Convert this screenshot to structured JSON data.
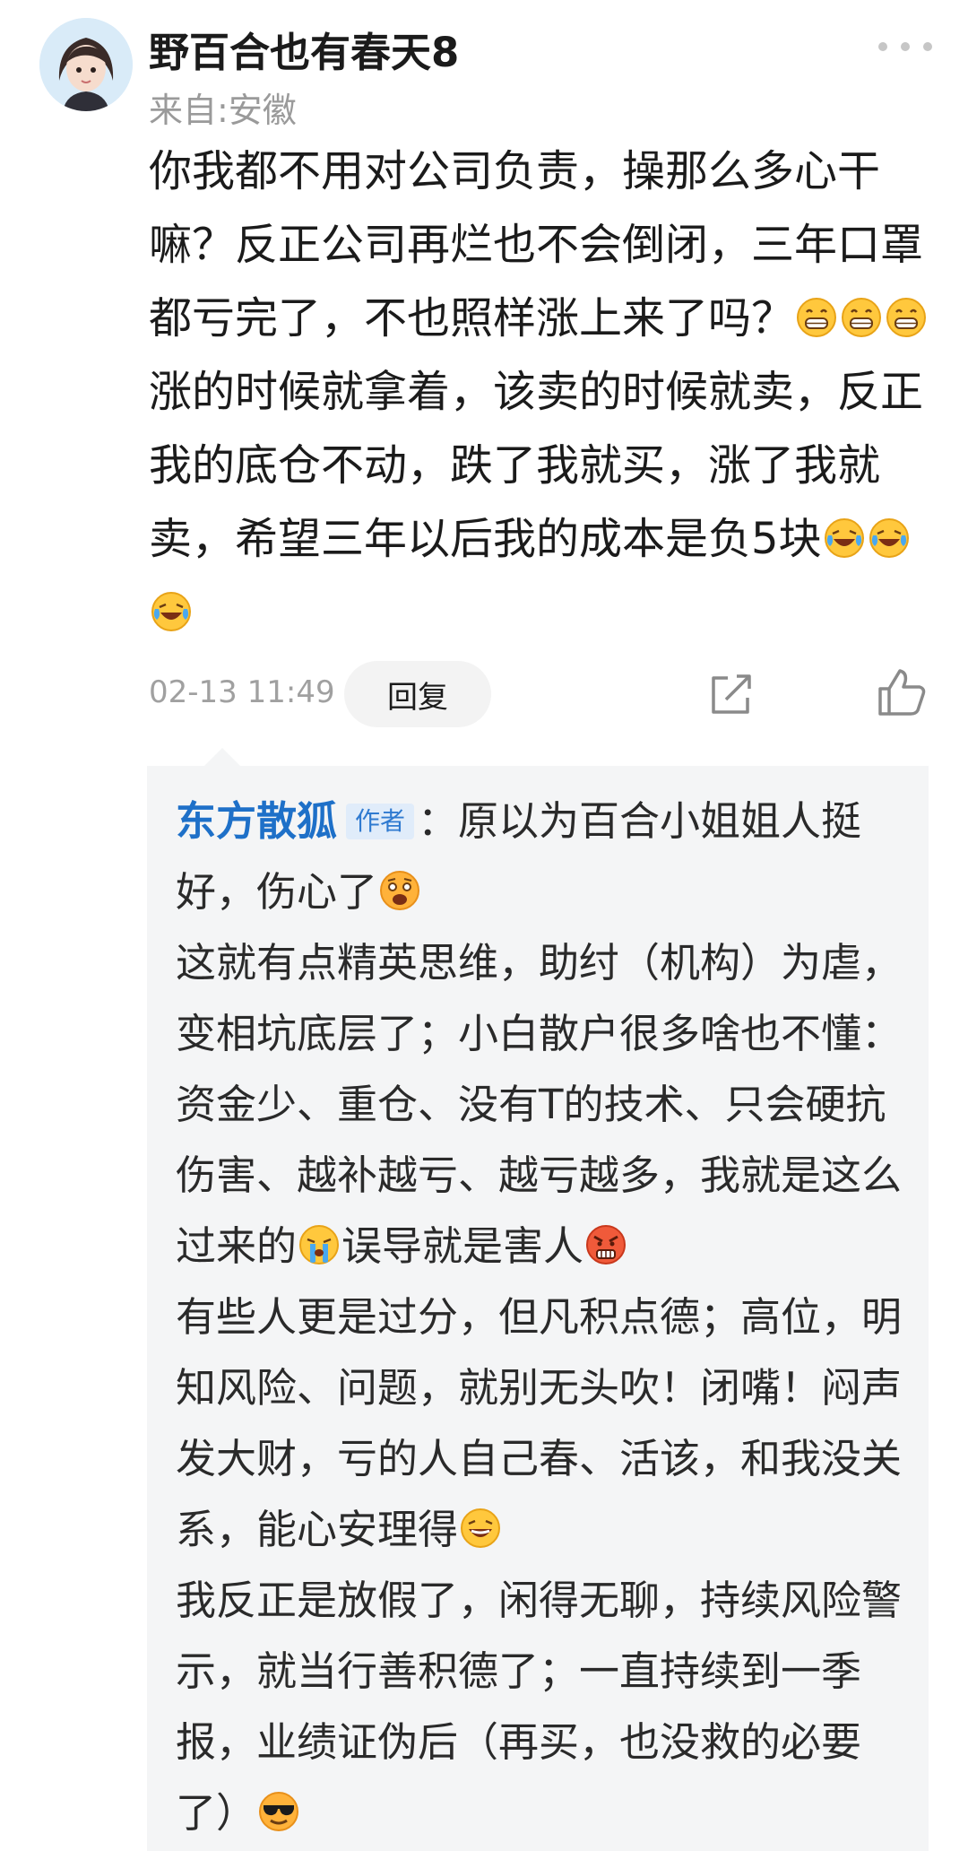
{
  "post": {
    "username": "野百合也有春天8",
    "location": "来自:安徽",
    "comment_parts": [
      "你我都不用对公司负责，操那么多心干嘛？反正公司再烂也不会倒闭，三年口罩都亏完了，不也照样涨上来了吗？",
      "涨的时候就拿着，该卖的时候就卖，反正我的底仓不动，跌了我就买，涨了我就卖，希望三年以后我的成本是负5块"
    ],
    "time": "02-13 11:49",
    "reply_label": "回复"
  },
  "quote": {
    "author": "东方散狐",
    "author_badge": "作者",
    "separator": "：",
    "p1": "原以为百合小姐姐人挺好，伤心了",
    "p2a": "这就有点精英思维，助纣（机构）为虐，变相坑底层了；小白散户很多啥也不懂：资金少、重仓、没有T的技术、只会硬抗伤害、越补越亏、越亏越多，我就是这么过来的",
    "p2b": "误导就是害人",
    "p3": "有些人更是过分，但凡积点德；高位，明知风险、问题，就别无头吹！闭嘴！闷声发大财，亏的人自己春、活该，和我没关系，能心安理得",
    "p4": "我反正是放假了，闲得无聊，持续风险警示，就当行善积德了；一直持续到一季报，业绩证伪后（再买，也没救的必要了）"
  },
  "icons": {
    "more": "more-dots-icon",
    "share": "share-icon",
    "like": "thumbs-up-icon",
    "emoji_grin": "grin-emoji",
    "emoji_laugh_cry": "laugh-cry-emoji",
    "emoji_scared": "scared-emoji",
    "emoji_cry": "crying-emoji",
    "emoji_angry": "angry-emoji",
    "emoji_laugh": "laugh-emoji",
    "emoji_cool": "sunglasses-emoji"
  }
}
